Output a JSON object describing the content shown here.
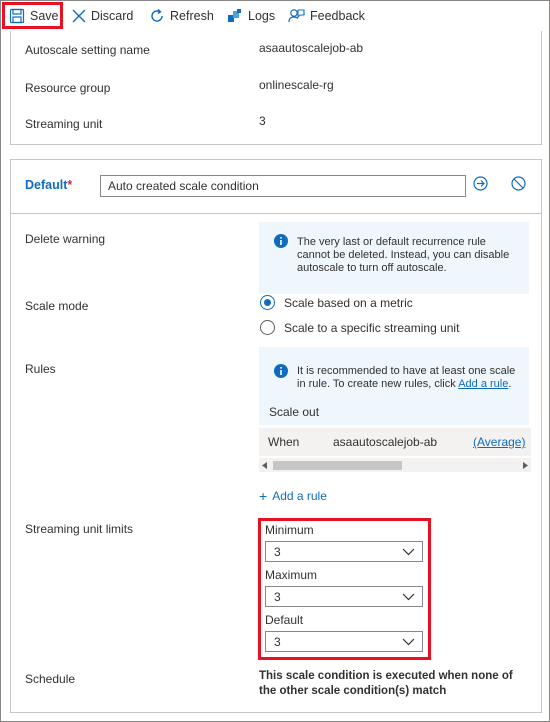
{
  "toolbar": {
    "save_label": "Save",
    "discard_label": "Discard",
    "refresh_label": "Refresh",
    "logs_label": "Logs",
    "feedback_label": "Feedback"
  },
  "settings": {
    "autoscale_name_label": "Autoscale setting name",
    "autoscale_name_value": "asaautoscalejob-ab",
    "resource_group_label": "Resource group",
    "resource_group_value": "onlinescale-rg",
    "streaming_unit_label": "Streaming unit",
    "streaming_unit_value": "3"
  },
  "condition": {
    "title": "Default",
    "required_mark": "*",
    "name_value": "Auto created scale condition",
    "delete_warning_label": "Delete warning",
    "delete_warning_text": "The very last or default recurrence rule cannot be deleted. Instead, you can disable autoscale to turn off autoscale.",
    "scale_mode_label": "Scale mode",
    "scale_mode_options": [
      "Scale based on a metric",
      "Scale to a specific streaming unit"
    ],
    "scale_mode_selected": 0,
    "rules_label": "Rules",
    "rules_info_text": "It is recommended to have at least one scale in rule. To create new rules, click ",
    "rules_info_link": "Add a rule",
    "rules_info_end": ".",
    "scale_out_label": "Scale out",
    "rule_row": {
      "when": "When",
      "resource": "asaautoscalejob-ab",
      "aggregation": "(Average)"
    },
    "add_rule_label": "Add a rule",
    "limits_label": "Streaming unit limits",
    "minimum_label": "Minimum",
    "minimum_value": "3",
    "maximum_label": "Maximum",
    "maximum_value": "3",
    "default_label": "Default",
    "default_value": "3",
    "schedule_label": "Schedule",
    "schedule_text": "This scale condition is executed when none of the other scale condition(s) match"
  },
  "colors": {
    "accent": "#0f6cbd",
    "highlight": "#e81123",
    "info_bg": "#eff6fc"
  }
}
